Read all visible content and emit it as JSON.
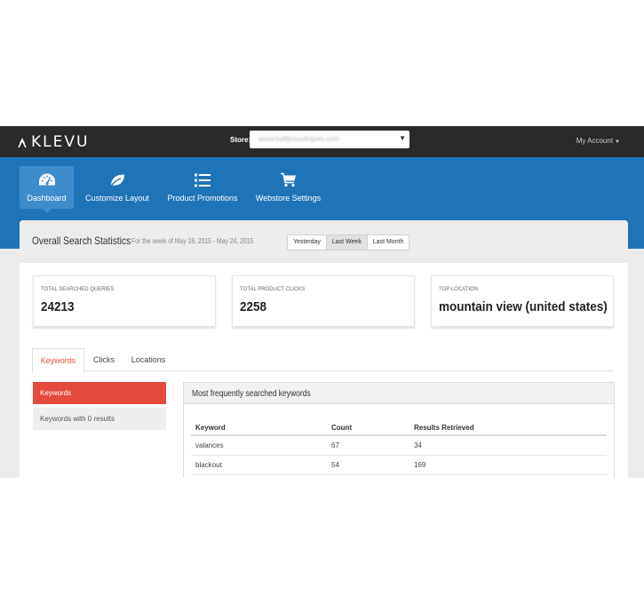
{
  "brand": {
    "name": "KLEVU"
  },
  "topbar": {
    "store_label": "Store:",
    "store_value": "www.halfpricedrapes.com",
    "account_label": "My Account"
  },
  "nav": {
    "items": [
      {
        "label": "Dashboard",
        "icon": "dashboard-gauge-icon",
        "active": true
      },
      {
        "label": "Customize Layout",
        "icon": "leaf-icon",
        "active": false
      },
      {
        "label": "Product Promotions",
        "icon": "list-icon",
        "active": false
      },
      {
        "label": "Webstore Settings",
        "icon": "cart-icon",
        "active": false
      }
    ]
  },
  "stats": {
    "title": "Overall Search Statistics",
    "subtitle": "For the week of May 18, 2015 - May 24, 2015",
    "ranges": [
      {
        "label": "Yesterday",
        "active": false
      },
      {
        "label": "Last Week",
        "active": true
      },
      {
        "label": "Last Month",
        "active": false
      }
    ],
    "cards": [
      {
        "label": "Total searched queries",
        "value": "24213"
      },
      {
        "label": "Total product clicks",
        "value": "2258"
      },
      {
        "label": "Top location",
        "value": "mountain view (united states)"
      }
    ]
  },
  "tabs": [
    {
      "label": "Keywords",
      "active": true
    },
    {
      "label": "Clicks",
      "active": false
    },
    {
      "label": "Locations",
      "active": false
    }
  ],
  "sidebar": {
    "items": [
      {
        "label": "Keywords",
        "active": true
      },
      {
        "label": "Keywords with 0 results",
        "active": false
      }
    ]
  },
  "keywords_panel": {
    "title": "Most frequently searched keywords",
    "columns": [
      "Keyword",
      "Count",
      "Results Retrieved"
    ],
    "rows": [
      [
        "valances",
        "67",
        "34"
      ],
      [
        "blackout",
        "54",
        "169"
      ]
    ]
  },
  "colors": {
    "topbar": "#2a2a2a",
    "nav": "#1f74b8",
    "nav_active": "#3d8ccb",
    "accent_red": "#e54a3c"
  }
}
